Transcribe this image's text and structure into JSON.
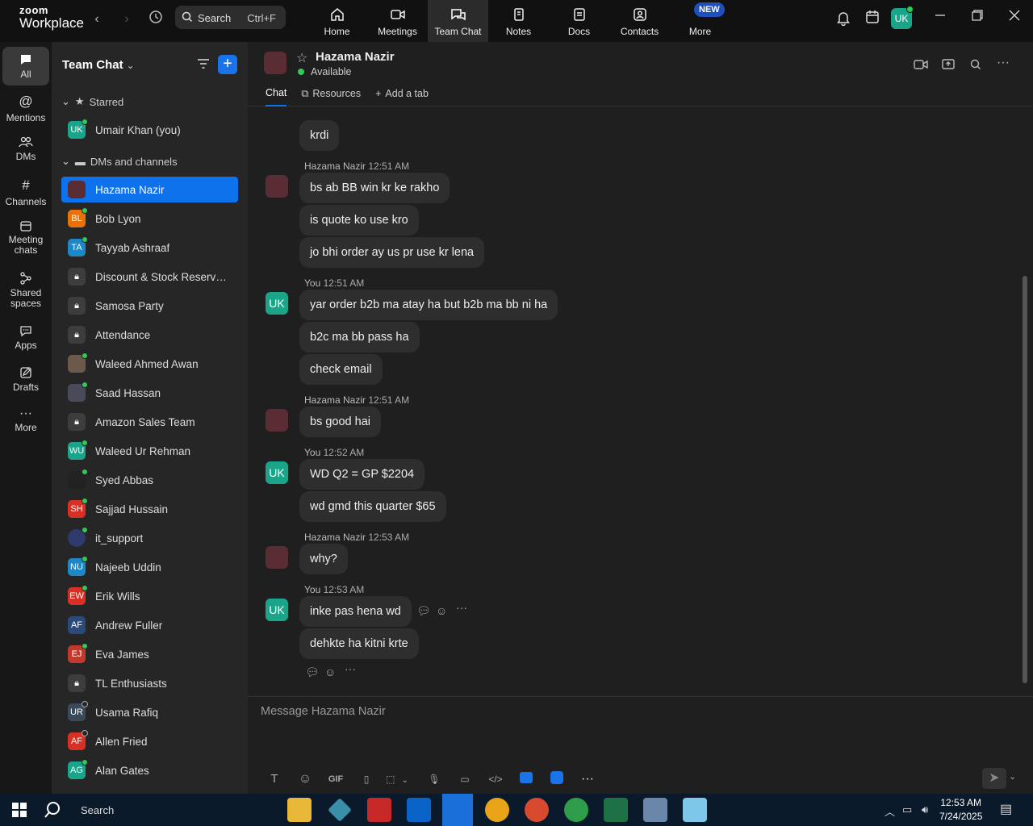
{
  "app": {
    "logo_top": "zoom",
    "logo_bottom": "Workplace",
    "search_label": "Search",
    "search_shortcut": "Ctrl+F",
    "nav": [
      {
        "label": "Home"
      },
      {
        "label": "Meetings"
      },
      {
        "label": "Team Chat"
      },
      {
        "label": "Notes"
      },
      {
        "label": "Docs"
      },
      {
        "label": "Contacts"
      },
      {
        "label": "More"
      }
    ],
    "new_badge": "NEW",
    "user_initials": "UK"
  },
  "rail": [
    {
      "label": "All"
    },
    {
      "label": "Mentions"
    },
    {
      "label": "DMs"
    },
    {
      "label": "Channels"
    },
    {
      "label": "Meeting chats"
    },
    {
      "label": "Shared spaces"
    },
    {
      "label": "Apps"
    },
    {
      "label": "Drafts"
    },
    {
      "label": "More"
    }
  ],
  "sidebar": {
    "title": "Team Chat",
    "starred_label": "Starred",
    "dms_label": "DMs and channels",
    "starred": [
      {
        "initials": "UK",
        "name": "Umair Khan (you)",
        "color": "#1aa58a"
      }
    ],
    "items": [
      {
        "initials": "",
        "name": "Hazama Nazir",
        "color": "#5a2d35"
      },
      {
        "initials": "BL",
        "name": "Bob Lyon",
        "color": "#e8710a"
      },
      {
        "initials": "TA",
        "name": "Tayyab Ashraaf",
        "color": "#1e88c7"
      },
      {
        "initials": "",
        "name": "Discount & Stock Reservati...",
        "color": "#3d3d3d"
      },
      {
        "initials": "",
        "name": "Samosa Party",
        "color": "#3d3d3d"
      },
      {
        "initials": "",
        "name": "Attendance",
        "color": "#3d3d3d"
      },
      {
        "initials": "",
        "name": "Waleed Ahmed Awan",
        "color": "#6b5a4a"
      },
      {
        "initials": "",
        "name": "Saad Hassan",
        "color": "#4a4a5a"
      },
      {
        "initials": "",
        "name": "Amazon Sales Team",
        "color": "#3d3d3d"
      },
      {
        "initials": "WU",
        "name": "Waleed Ur Rehman",
        "color": "#1aa58a"
      },
      {
        "initials": "",
        "name": "Syed Abbas",
        "color": "#222"
      },
      {
        "initials": "SH",
        "name": "Sajjad Hussain",
        "color": "#d93025"
      },
      {
        "initials": "",
        "name": "it_support",
        "color": "#2d3a6b"
      },
      {
        "initials": "NU",
        "name": "Najeeb Uddin",
        "color": "#1e88c7"
      },
      {
        "initials": "EW",
        "name": "Erik Wills",
        "color": "#d93025"
      },
      {
        "initials": "AF",
        "name": "Andrew Fuller",
        "color": "#2b4a7a"
      },
      {
        "initials": "EJ",
        "name": "Eva James",
        "color": "#c0392b"
      },
      {
        "initials": "",
        "name": "TL Enthusiasts",
        "color": "#3d3d3d"
      },
      {
        "initials": "UR",
        "name": "Usama Rafiq",
        "color": "#3a4a5a"
      },
      {
        "initials": "AF",
        "name": "Allen Fried",
        "color": "#d93025"
      },
      {
        "initials": "AG",
        "name": "Alan Gates",
        "color": "#1aa58a"
      }
    ]
  },
  "chat": {
    "contact_name": "Hazama Nazir",
    "contact_status": "Available",
    "tabs": [
      "Chat",
      "Resources",
      "Add a tab"
    ],
    "messages": {
      "m0": "krdi",
      "g1_name": "Hazama Nazir",
      "g1_time": "12:51 AM",
      "m1": "bs ab BB win kr ke rakho",
      "m2": "is quote ko use kro",
      "m3": "jo bhi order ay us pr use kr lena",
      "g2_name": "You",
      "g2_time": "12:51 AM",
      "m4": "yar order b2b ma atay ha but b2b ma bb ni ha",
      "m5": "b2c ma bb pass ha",
      "m6": "check email",
      "g3_name": "Hazama Nazir",
      "g3_time": "12:51 AM",
      "m7": "bs good hai",
      "g4_name": "You",
      "g4_time": "12:52 AM",
      "m8": "WD Q2 = GP $2204",
      "m9": "wd gmd this quarter $65",
      "g5_name": "Hazama Nazir",
      "g5_time": "12:53 AM",
      "m10": "why?",
      "g6_name": "You",
      "g6_time": "12:53 AM",
      "m11": "inke pas hena wd",
      "m12": "dehkte ha kitni krte"
    },
    "composer_placeholder": "Message Hazama Nazir",
    "gif_label": "GIF"
  },
  "taskbar": {
    "search_label": "Search",
    "time": "12:53 AM",
    "date": "7/24/2025"
  }
}
